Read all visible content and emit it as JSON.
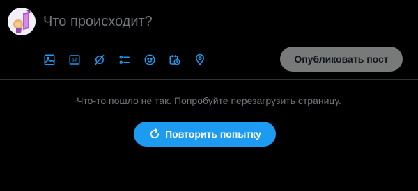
{
  "composer": {
    "placeholder": "Что происходит?",
    "tools": [
      {
        "icon": "image-icon"
      },
      {
        "icon": "gif-icon",
        "label": "GIF"
      },
      {
        "icon": "grok-icon"
      },
      {
        "icon": "poll-icon"
      },
      {
        "icon": "emoji-icon"
      },
      {
        "icon": "schedule-icon"
      },
      {
        "icon": "location-icon"
      }
    ],
    "publish_label": "Опубликовать пост"
  },
  "feed_error": {
    "message": "Что-то пошло не так. Попробуйте перезагрузить страницу.",
    "retry_label": "Повторить попытку",
    "retry_icon": "refresh-icon"
  },
  "colors": {
    "background": "#000000",
    "accent": "#1d9bf0",
    "muted_text": "#71767b",
    "publish_disabled": "#787a7a",
    "divider": "#2f3336"
  }
}
